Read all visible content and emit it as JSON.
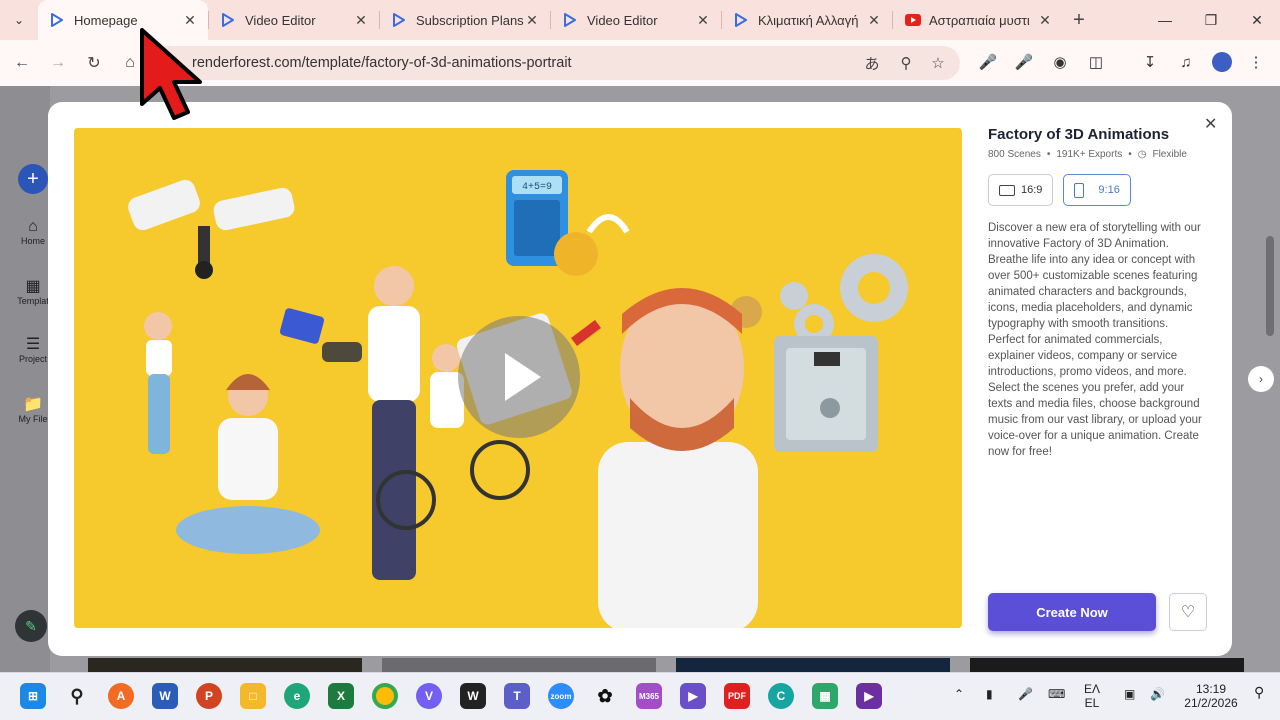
{
  "tabs": [
    {
      "label": "Homepage",
      "favicon": "renderforest-icon",
      "color": "#3b6de0",
      "active": true
    },
    {
      "label": "Video Editor",
      "favicon": "renderforest-icon",
      "color": "#3b6de0"
    },
    {
      "label": "Subscription Plans",
      "favicon": "renderforest-icon",
      "color": "#3b6de0"
    },
    {
      "label": "Video Editor",
      "favicon": "renderforest-icon",
      "color": "#3b6de0"
    },
    {
      "label": "Κλιματική Αλλαγή",
      "favicon": "renderforest-icon",
      "color": "#3b6de0"
    },
    {
      "label": "Αστραπιαία μυστι",
      "favicon": "youtube-icon",
      "color": "#e62117"
    }
  ],
  "address": {
    "url": "renderforest.com/template/factory-of-3d-animations-portrait"
  },
  "sidebar": {
    "items": [
      {
        "label": "Home"
      },
      {
        "label": "Templat"
      },
      {
        "label": "Project"
      },
      {
        "label": "My File"
      }
    ]
  },
  "modal": {
    "title": "Factory of 3D Animations",
    "scenes": "800 Scenes",
    "exports": "191K+ Exports",
    "flexible": "Flexible",
    "ratio_landscape": "16:9",
    "ratio_portrait": "9:16",
    "description": "Discover a new era of storytelling with our innovative Factory of 3D Animation. Breathe life into any idea or concept with over 500+ customizable scenes featuring animated characters and backgrounds, icons, media placeholders, and dynamic typography with smooth transitions. Perfect for animated commercials, explainer videos, company or service introductions, promo videos, and more. Select the scenes you prefer, add your texts and media files, choose background music from our vast library, or upload your voice-over for a unique animation. Create now for free!",
    "create_label": "Create Now",
    "calculator_display": "4+5=9"
  },
  "taskbar": {
    "lang_1": "ΕΛ",
    "lang_2": "EL",
    "time": "13:19",
    "date": "21/2/2026"
  },
  "colors": {
    "accent": "#5a4fd6",
    "preview_bg": "#f6c92d",
    "tabbar": "#f9e1dd"
  }
}
